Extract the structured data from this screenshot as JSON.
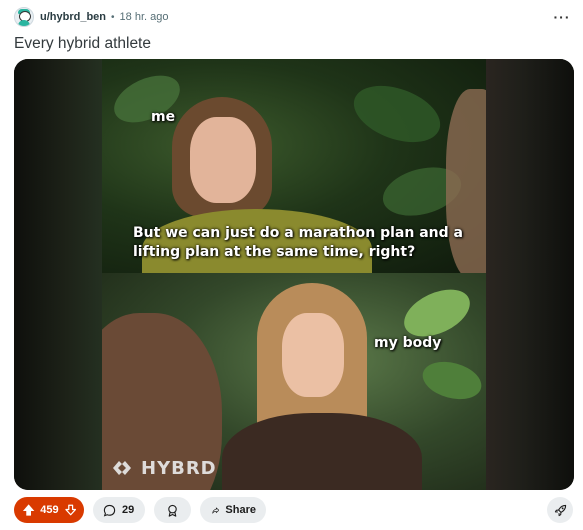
{
  "post": {
    "author": "u/hybrd_ben",
    "separator": "•",
    "time": "18 hr. ago",
    "more_label": "···",
    "title": "Every hybrid athlete"
  },
  "meme": {
    "label_top": "me",
    "caption_top": "But we can just do a marathon plan and a lifting plan at the same time, right?",
    "label_bottom": "my body",
    "watermark": "HYBRD"
  },
  "actions": {
    "upvotes": "459",
    "comments": "29",
    "share_label": "Share"
  },
  "colors": {
    "upvote_active": "#d93a00",
    "pill_bg": "#eaedef",
    "media_bg": "#0b0b0b"
  },
  "icons": {
    "avatar": "avatar-icon",
    "upvote": "arrow-up-icon",
    "downvote": "arrow-down-icon",
    "comments": "comment-bubble-icon",
    "award": "award-icon",
    "share": "share-arrow-icon",
    "boost": "rocket-icon"
  }
}
